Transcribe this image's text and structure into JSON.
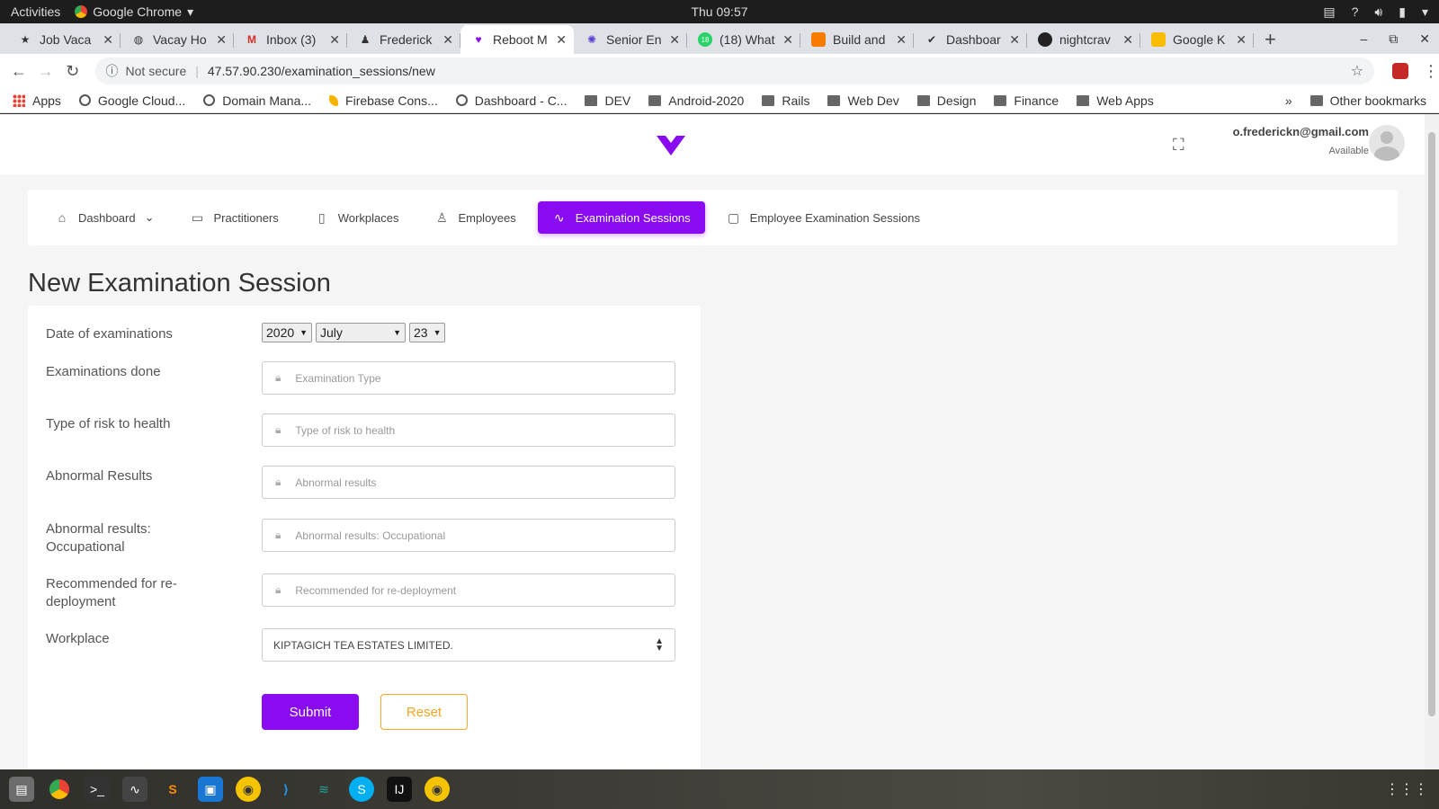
{
  "system": {
    "activities": "Activities",
    "app_name": "Google Chrome",
    "clock": "Thu 09:57"
  },
  "tabs": [
    {
      "title": "Job Vaca",
      "icon": "person-icon",
      "active": false
    },
    {
      "title": "Vacay Ho",
      "icon": "globe-icon",
      "active": false
    },
    {
      "title": "Inbox (3)",
      "icon": "gmail-icon",
      "active": false
    },
    {
      "title": "Frederick",
      "icon": "user-icon",
      "active": false
    },
    {
      "title": "Reboot M",
      "icon": "reboot-logo-icon",
      "active": true
    },
    {
      "title": "Senior En",
      "icon": "gear-icon",
      "active": false
    },
    {
      "title": "(18) What",
      "icon": "whatsapp-icon",
      "active": false
    },
    {
      "title": "Build and",
      "icon": "box-icon",
      "active": false
    },
    {
      "title": "Dashboar",
      "icon": "check-icon",
      "active": false
    },
    {
      "title": "nightcrav",
      "icon": "github-icon",
      "active": false
    },
    {
      "title": "Google K",
      "icon": "keep-icon",
      "active": false
    }
  ],
  "address": {
    "security": "Not secure",
    "url": "47.57.90.230/examination_sessions/new"
  },
  "bookmarks": {
    "items": [
      {
        "label": "Apps",
        "icon": "apps-grid-icon"
      },
      {
        "label": "Google Cloud...",
        "icon": "globe-icon"
      },
      {
        "label": "Domain Mana...",
        "icon": "globe-icon"
      },
      {
        "label": "Firebase Cons...",
        "icon": "firebase-icon"
      },
      {
        "label": "Dashboard - C...",
        "icon": "globe-icon"
      },
      {
        "label": "DEV",
        "icon": "folder-icon"
      },
      {
        "label": "Android-2020",
        "icon": "folder-icon"
      },
      {
        "label": "Rails",
        "icon": "folder-icon"
      },
      {
        "label": "Web Dev",
        "icon": "folder-icon"
      },
      {
        "label": "Design",
        "icon": "folder-icon"
      },
      {
        "label": "Finance",
        "icon": "folder-icon"
      },
      {
        "label": "Web Apps",
        "icon": "folder-icon"
      }
    ],
    "overflow": "»",
    "other": "Other bookmarks"
  },
  "header": {
    "email": "o.frederickn@gmail.com",
    "status": "Available"
  },
  "nav": {
    "items": [
      {
        "label": "Dashboard",
        "icon": "home-icon",
        "caret": "⌄"
      },
      {
        "label": "Practitioners",
        "icon": "monitor-icon"
      },
      {
        "label": "Workplaces",
        "icon": "clipboard-icon"
      },
      {
        "label": "Employees",
        "icon": "users-icon"
      },
      {
        "label": "Examination Sessions",
        "icon": "activity-icon"
      },
      {
        "label": "Employee Examination Sessions",
        "icon": "file-icon"
      }
    ],
    "active_index": 4
  },
  "page": {
    "title": "New Examination Session"
  },
  "form": {
    "date_label": "Date of examinations",
    "year": "2020",
    "month": "July",
    "day": "23",
    "fields": [
      {
        "label": "Examinations done",
        "placeholder": "Examination Type"
      },
      {
        "label": "Type of risk to health",
        "placeholder": "Type of risk to health"
      },
      {
        "label": "Abnormal Results",
        "placeholder": "Abnormal results"
      },
      {
        "label": "Abnormal results: Occupational",
        "placeholder": "Abnormal results: Occupational"
      },
      {
        "label": "Recommended for re-deployment",
        "placeholder": "Recommended for re-deployment"
      }
    ],
    "workplace_label": "Workplace",
    "workplace_value": "KIPTAGICH TEA ESTATES LIMITED.",
    "submit_label": "Submit",
    "reset_label": "Reset"
  },
  "colors": {
    "accent": "#8a0bf0",
    "reset": "#f5a623"
  }
}
